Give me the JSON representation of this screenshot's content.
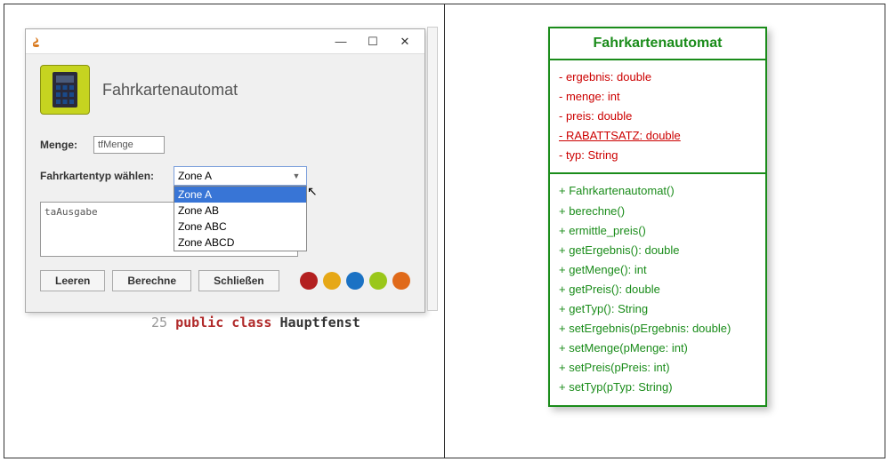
{
  "window": {
    "controls": {
      "min": "—",
      "max": "☐",
      "close": "✕"
    }
  },
  "app": {
    "title": "Fahrkartenautomat",
    "menge_label": "Menge:",
    "menge_value": "tfMenge",
    "typ_label": "Fahrkartentyp wählen:",
    "combo_selected": "Zone A",
    "combo_items": [
      "Zone A",
      "Zone AB",
      "Zone ABC",
      "Zone ABCD"
    ],
    "ausgabe_value": "taAusgabe",
    "btn_leeren": "Leeren",
    "btn_berechne": "Berechne",
    "btn_schliessen": "Schließen",
    "dot_colors": [
      "#b32020",
      "#e6a817",
      "#1b72c4",
      "#9ac71a",
      "#e06a1a"
    ]
  },
  "code": {
    "lineno": "25",
    "kw": "public class",
    "cls": "Hauptfenst"
  },
  "uml": {
    "class_name": "Fahrkartenautomat",
    "attributes": [
      {
        "text": "- ergebnis: double",
        "static": false
      },
      {
        "text": "- menge: int",
        "static": false
      },
      {
        "text": "- preis: double",
        "static": false
      },
      {
        "text": "- RABATTSATZ: double",
        "static": true
      },
      {
        "text": "- typ: String",
        "static": false
      }
    ],
    "methods": [
      "+ Fahrkartenautomat()",
      "+ berechne()",
      "+ ermittle_preis()",
      "+ getErgebnis(): double",
      "+ getMenge(): int",
      "+ getPreis(): double",
      "+ getTyp(): String",
      "+ setErgebnis(pErgebnis: double)",
      "+ setMenge(pMenge: int)",
      "+ setPreis(pPreis: int)",
      "+ setTyp(pTyp: String)"
    ]
  }
}
